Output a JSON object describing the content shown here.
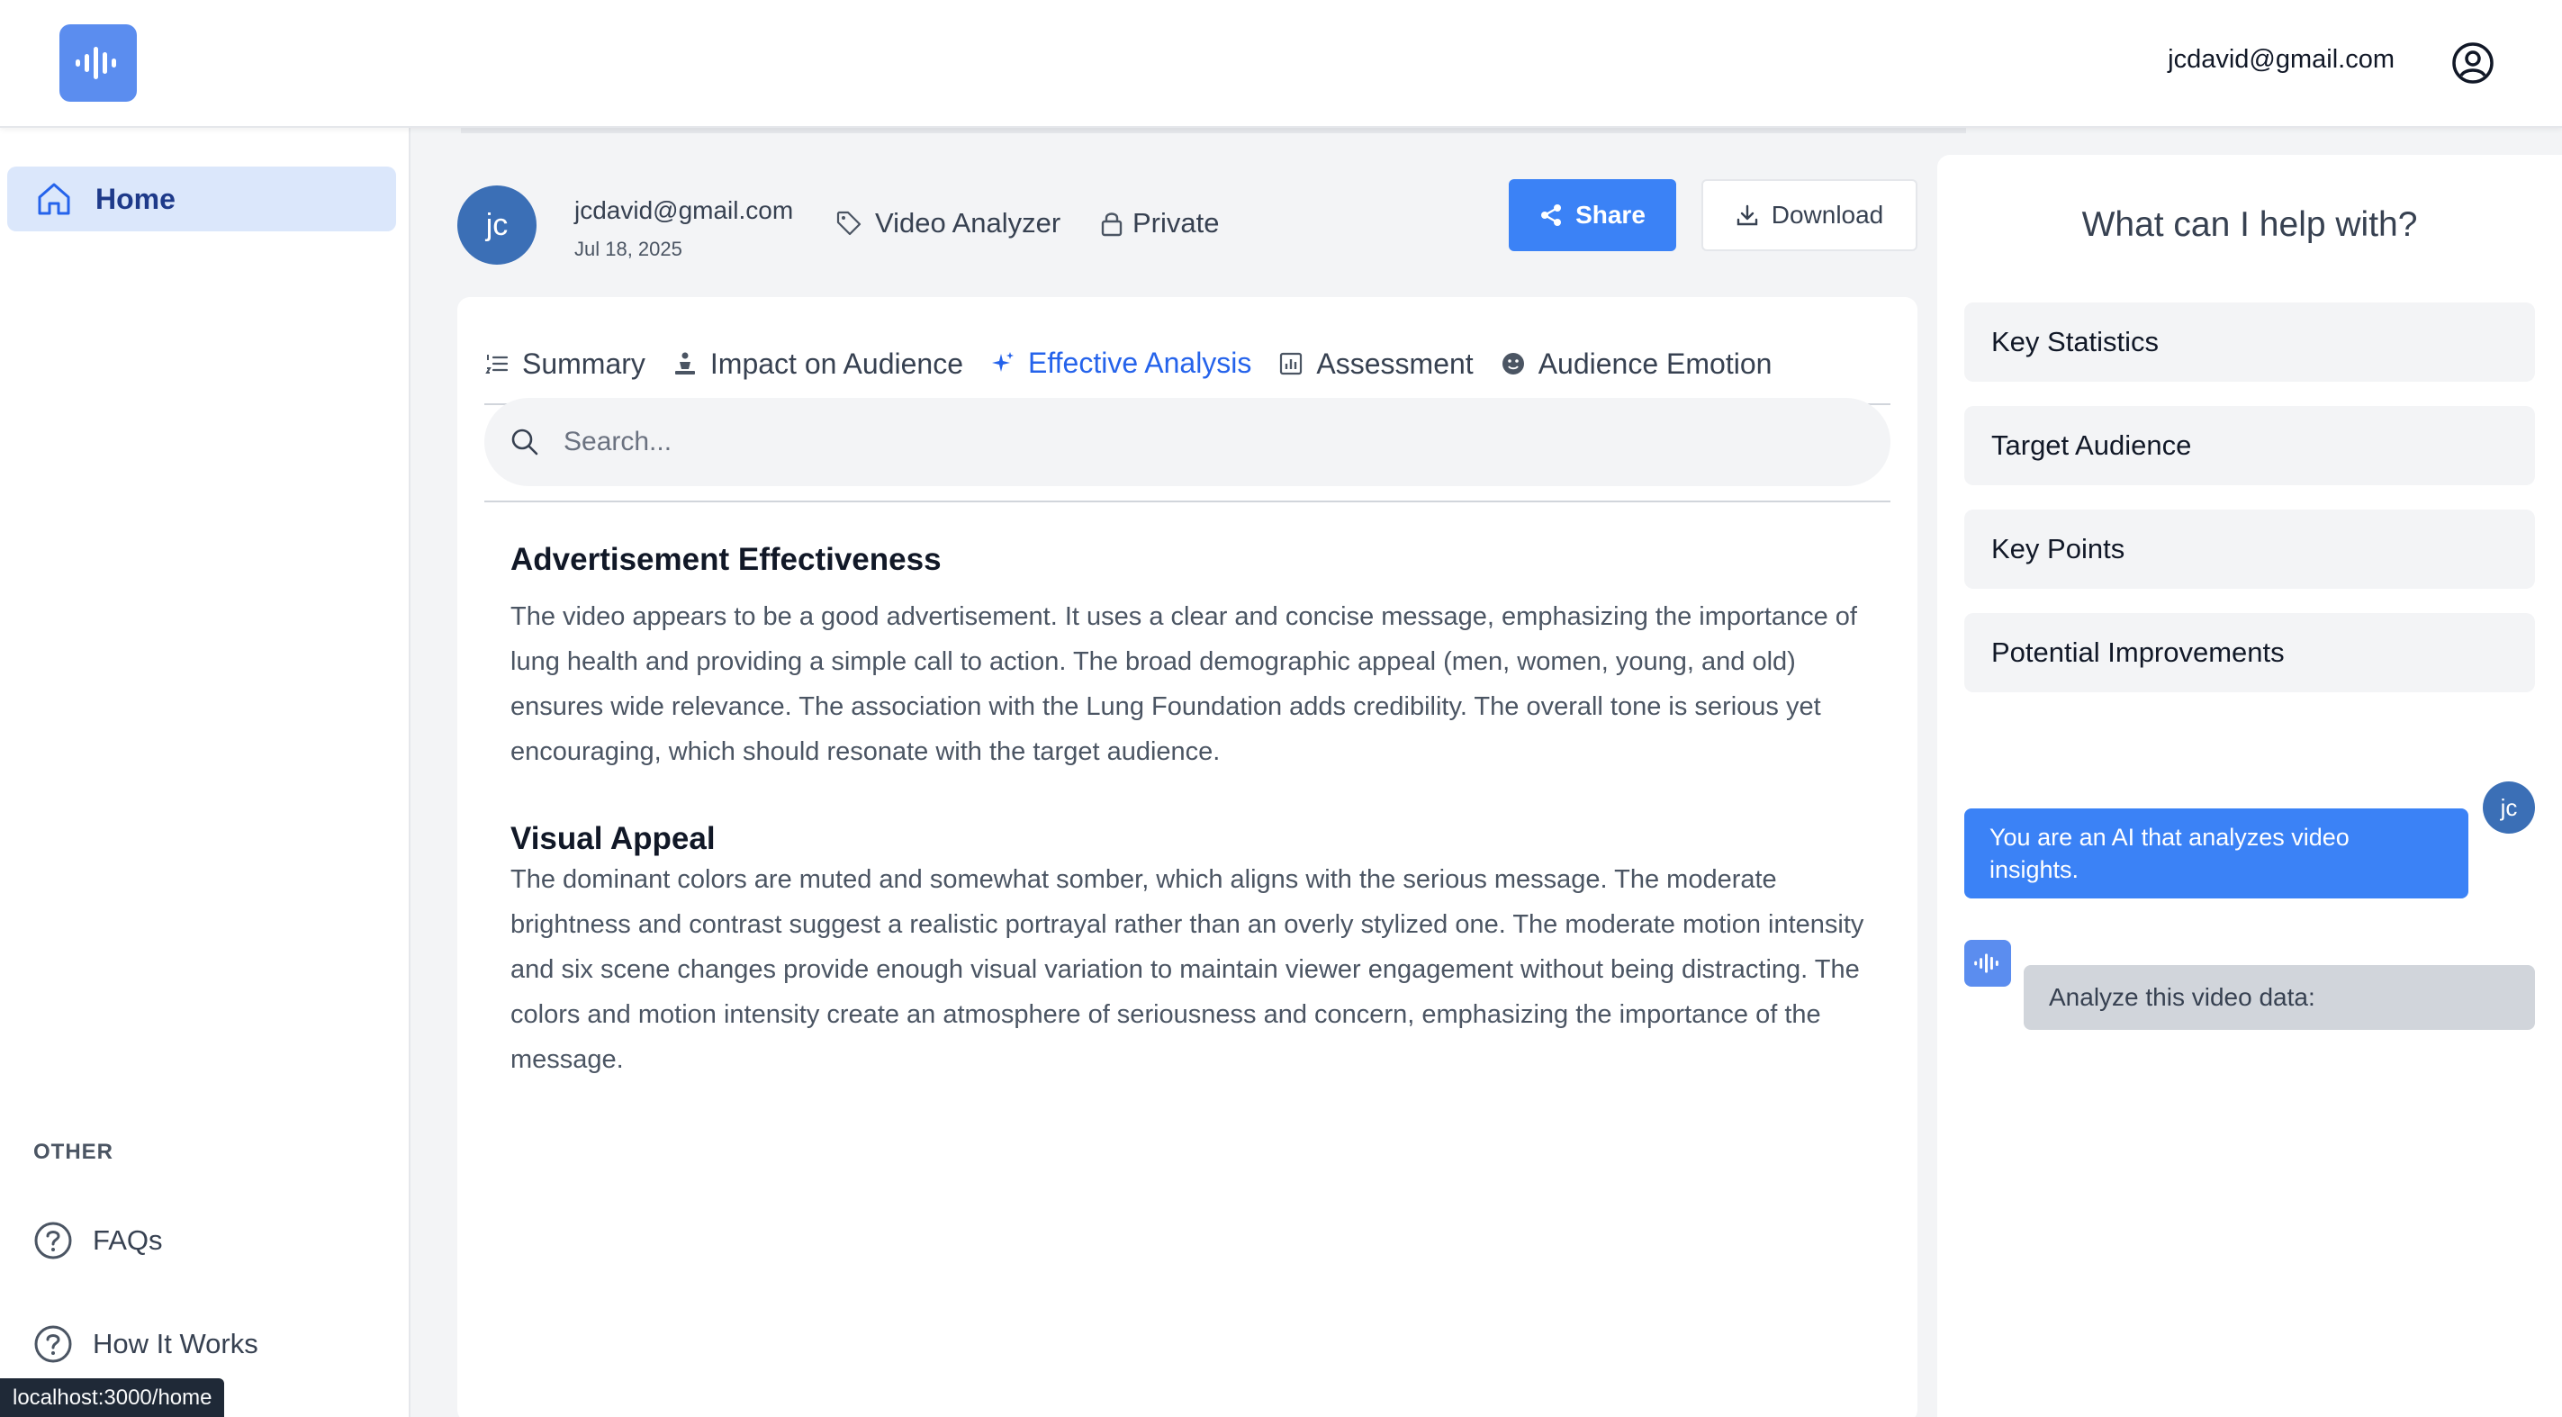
{
  "header": {
    "logo_icon": "audio-waveform-icon",
    "user_email": "jcdavid@gmail.com",
    "user_icon": "user-circle-icon"
  },
  "sidebar": {
    "home_label": "Home",
    "other_label": "OTHER",
    "faqs_label": "FAQs",
    "how_label": "How It Works"
  },
  "video": {
    "avatar_initials": "jc",
    "owner_email": "jcdavid@gmail.com",
    "date": "Jul 18, 2025",
    "tag": "Video Analyzer",
    "visibility": "Private",
    "share_label": "Share",
    "download_label": "Download"
  },
  "tabs": [
    {
      "label": "Summary",
      "icon": "list-ordered-icon"
    },
    {
      "label": "Impact on Audience",
      "icon": "person-icon"
    },
    {
      "label": "Effective Analysis",
      "icon": "sparkle-icon",
      "active": true
    },
    {
      "label": "Assessment",
      "icon": "bar-chart-icon"
    },
    {
      "label": "Audience Emotion",
      "icon": "smiley-icon"
    }
  ],
  "search": {
    "placeholder": "Search..."
  },
  "content": {
    "section1_title": "Advertisement Effectiveness",
    "section1_body": "The video appears to be a good advertisement. It uses a clear and concise message, emphasizing the importance of lung health and providing a simple call to action. The broad demographic appeal (men, women, young, and old) ensures wide relevance. The association with the Lung Foundation adds credibility. The overall tone is serious yet encouraging, which should resonate with the target audience.",
    "section2_title": "Visual Appeal",
    "section2_body": "The dominant colors are muted and somewhat somber, which aligns with the serious message. The moderate brightness and contrast suggest a realistic portrayal rather than an overly stylized one. The moderate motion intensity and six scene changes provide enough visual variation to maintain viewer engagement without being distracting. The colors and motion intensity create an atmosphere of seriousness and concern, emphasizing the importance of the message."
  },
  "assistant": {
    "title": "What can I help with?",
    "suggestions": [
      "Key Statistics",
      "Target Audience",
      "Key Points",
      "Potential Improvements"
    ],
    "user_message": "You are an AI that analyzes video insights.",
    "user_initials": "jc",
    "bot_message": "Analyze this video data:"
  },
  "status_bar": {
    "url": "localhost:3000/home"
  },
  "colors": {
    "accent": "#3b82f6",
    "logo": "#5b8def",
    "avatar": "#3b6fb6",
    "active_nav_bg": "#dbe7fb"
  }
}
